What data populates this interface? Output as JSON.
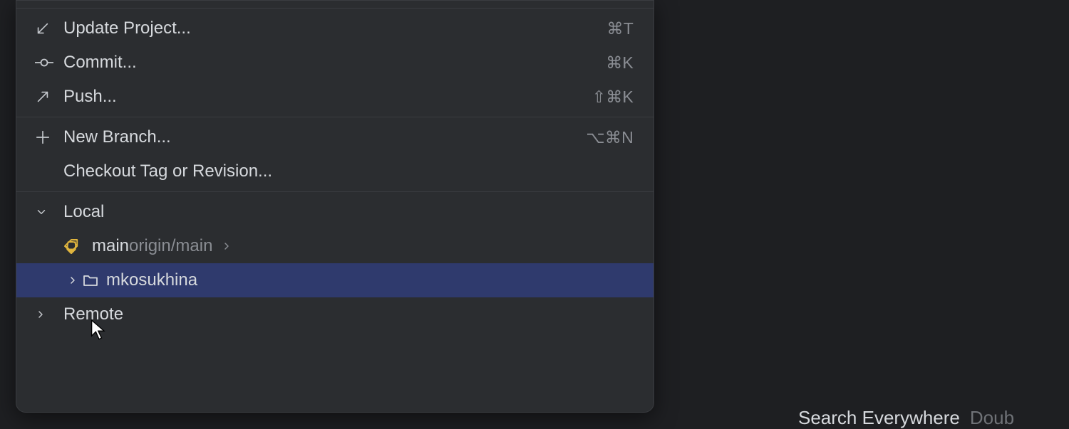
{
  "menu": {
    "update": {
      "label": "Update Project...",
      "shortcut": "⌘T"
    },
    "commit": {
      "label": "Commit...",
      "shortcut": "⌘K"
    },
    "push": {
      "label": "Push...",
      "shortcut": "⇧⌘K"
    },
    "newbranch": {
      "label": "New Branch...",
      "shortcut": "⌥⌘N"
    },
    "checkout": {
      "label": "Checkout Tag or Revision..."
    }
  },
  "tree": {
    "local_label": "Local",
    "remote_label": "Remote",
    "main": {
      "name": "main",
      "tracking": "origin/main"
    },
    "folder": {
      "name": "mkosukhina"
    }
  },
  "hint": {
    "label": "Search Everywhere",
    "rest": "Doub"
  }
}
